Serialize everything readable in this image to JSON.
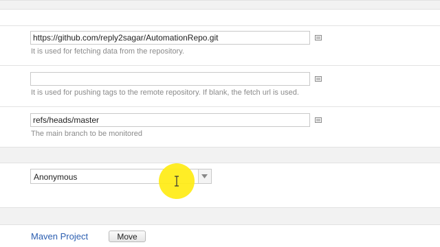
{
  "repository": {
    "fetch_url": {
      "value": "https://github.com/reply2sagar/AutomationRepo.git",
      "help": "It is used for fetching data from the repository."
    },
    "push_url": {
      "value": "",
      "help": "It is used for pushing tags to the remote repository. If blank, the fetch url is used."
    },
    "branch": {
      "value": "refs/heads/master",
      "help": "The main branch to be monitored"
    }
  },
  "credentials": {
    "selected": "Anonymous"
  },
  "footer": {
    "link_label": "Maven Project",
    "move_label": "Move"
  },
  "icons": {
    "note": "notepad-icon",
    "dropdown": "chevron-down-icon",
    "cursor": "text-cursor-icon"
  }
}
